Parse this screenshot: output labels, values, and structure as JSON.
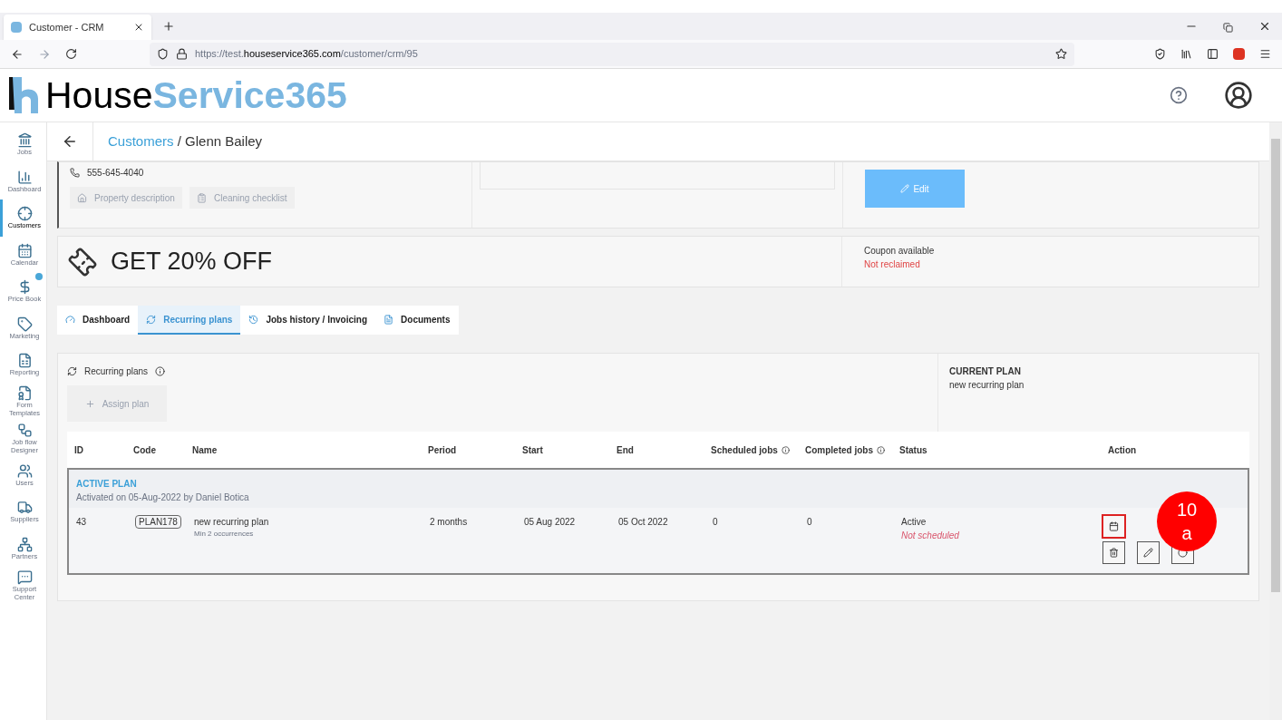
{
  "browser": {
    "tab_title": "Customer - CRM",
    "url_prefix": "https://test.",
    "url_domain": "houseservice365.com",
    "url_path": "/customer/crm/95"
  },
  "header": {
    "logo_dark": "House",
    "logo_light": "Service365"
  },
  "sidebar": {
    "items": [
      {
        "label": "Jobs",
        "kind": "jobs",
        "selected": false
      },
      {
        "label": "Dashboard",
        "kind": "chart",
        "selected": false
      },
      {
        "label": "Customers",
        "kind": "target",
        "selected": true
      },
      {
        "label": "Calendar",
        "kind": "calendar",
        "selected": false
      },
      {
        "label": "Price Book",
        "kind": "price",
        "selected": false
      },
      {
        "label": "Marketing",
        "kind": "tag",
        "selected": false
      },
      {
        "label": "Reporting",
        "kind": "report",
        "selected": false
      },
      {
        "label": "Form Templates",
        "kind": "form",
        "selected": false
      },
      {
        "label": "Job flow Designer",
        "kind": "flow",
        "selected": false
      },
      {
        "label": "Users",
        "kind": "users",
        "selected": false
      },
      {
        "label": "Suppliers",
        "kind": "truck",
        "selected": false
      },
      {
        "label": "Partners",
        "kind": "partners",
        "selected": false
      },
      {
        "label": "Support Center",
        "kind": "help",
        "selected": false
      }
    ]
  },
  "breadcrumb": {
    "parent": "Customers",
    "separator": "/",
    "current": "Glenn Bailey"
  },
  "customer_card": {
    "phone": "555-645-4040",
    "buttons": [
      "Property description",
      "Cleaning checklist"
    ],
    "edit_button": "Edit"
  },
  "coupon": {
    "title": "GET 20% OFF",
    "label": "Coupon available",
    "status": "Not reclaimed"
  },
  "tabs": [
    {
      "label": "Dashboard",
      "kind": "gauge",
      "selected": false
    },
    {
      "label": "Recurring plans",
      "kind": "refresh",
      "selected": true
    },
    {
      "label": "Jobs history / Invoicing",
      "kind": "history",
      "selected": false
    },
    {
      "label": "Documents",
      "kind": "doc",
      "selected": false
    }
  ],
  "plans": {
    "title": "Recurring plans",
    "assign_button": "Assign plan",
    "current_plan_label": "CURRENT PLAN",
    "current_plan_name": "new recurring plan",
    "columns": [
      {
        "label": "ID",
        "kind": "plain"
      },
      {
        "label": "Code",
        "kind": "plain"
      },
      {
        "label": "Name",
        "kind": "plain"
      },
      {
        "label": "Period",
        "kind": "plain"
      },
      {
        "label": "Start",
        "kind": "plain"
      },
      {
        "label": "End",
        "kind": "plain"
      },
      {
        "label": "Scheduled jobs",
        "kind": "info"
      },
      {
        "label": "Completed jobs",
        "kind": "info"
      },
      {
        "label": "Status",
        "kind": "plain"
      },
      {
        "label": "Action",
        "kind": "plain"
      }
    ],
    "group": {
      "title": "ACTIVE PLAN",
      "subtitle": "Activated on 05-Aug-2022 by Daniel Botica"
    },
    "row": {
      "id": "43",
      "code": "PLAN178",
      "name": "new recurring plan",
      "name_note": "Min 2 occurrences",
      "period": "2 months",
      "start": "05 Aug 2022",
      "end": "05 Oct 2022",
      "scheduled": "0",
      "completed": "0",
      "status": "Active",
      "status_note": "Not scheduled",
      "actions": [
        {
          "kind": "calendar",
          "highlighted": true
        },
        {
          "kind": "trash",
          "highlighted": false
        },
        {
          "kind": "pencil",
          "highlighted": false
        },
        {
          "kind": "circle",
          "highlighted": false
        }
      ]
    }
  },
  "step_badge": {
    "lines": [
      "10",
      "a"
    ]
  }
}
